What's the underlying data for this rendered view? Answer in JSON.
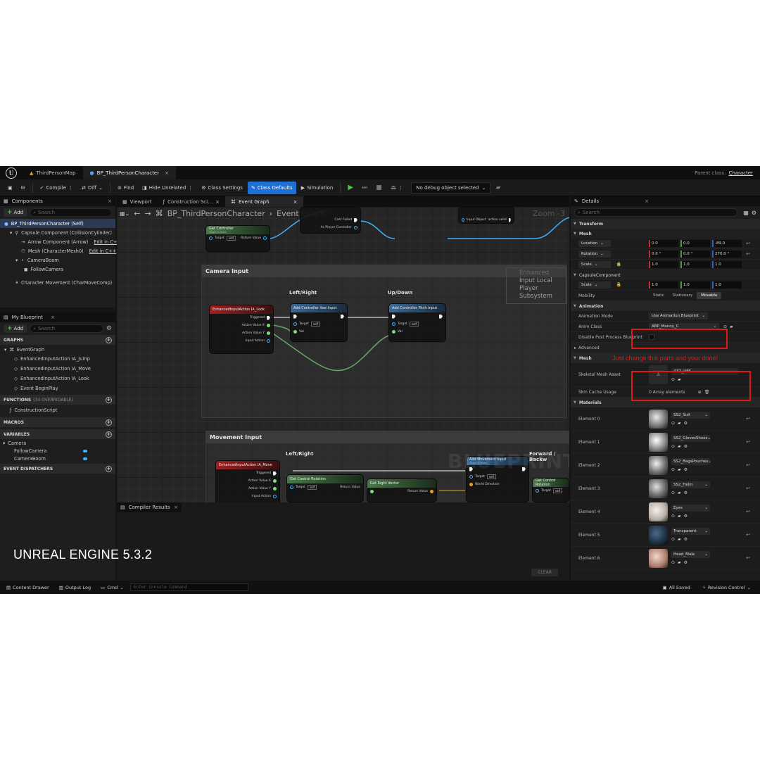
{
  "titlebar": {
    "tabs": [
      {
        "label": "ThirdPersonMap"
      },
      {
        "label": "BP_ThirdPersonCharacter"
      }
    ],
    "parent_class_label": "Parent class:",
    "parent_class_value": "Character"
  },
  "toolbar": {
    "compile": "Compile",
    "diff": "Diff",
    "find": "Find",
    "hide_unrelated": "Hide Unrelated",
    "class_settings": "Class Settings",
    "class_defaults": "Class Defaults",
    "simulation": "Simulation",
    "debug_object": "No debug object selected"
  },
  "components": {
    "title": "Components",
    "add": "Add",
    "search_placeholder": "Search",
    "items": [
      {
        "label": "BP_ThirdPersonCharacter (Self)"
      },
      {
        "label": "Capsule Component (CollisionCylinder)"
      },
      {
        "label": "Arrow Component (Arrow)",
        "link": "Edit in C++"
      },
      {
        "label": "Mesh (CharacterMesh0)",
        "link": "Edit in C++"
      },
      {
        "label": "CameraBoom"
      },
      {
        "label": "FollowCamera"
      },
      {
        "label": "Character Movement (CharMoveComp)"
      }
    ]
  },
  "my_blueprint": {
    "title": "My Blueprint",
    "add": "Add",
    "search_placeholder": "Search",
    "graphs_label": "GRAPHS",
    "event_graph": "EventGraph",
    "events": [
      "EnhancedInputAction IA_Jump",
      "EnhancedInputAction IA_Move",
      "EnhancedInputAction IA_Look",
      "Event BeginPlay"
    ],
    "functions_label": "FUNCTIONS",
    "functions_sub": "(34 OVERRIDABLE)",
    "functions": [
      "ConstructionScript"
    ],
    "macros_label": "MACROS",
    "variables_label": "VARIABLES",
    "var_category": "Camera",
    "variables": [
      "FollowCamera",
      "CameraBoom"
    ],
    "dispatchers_label": "EVENT DISPATCHERS"
  },
  "graph_tabs": [
    "Viewport",
    "Construction Scr...",
    "Event Graph"
  ],
  "graph": {
    "crumb_root": "BP_ThirdPersonCharacter",
    "crumb_leaf": "Event Graph",
    "zoom": "Zoom -3",
    "get_controller": "Get Controller",
    "target_is_pawn": "Target is Pawn",
    "target": "Target",
    "self": "self",
    "return_value": "Return Value",
    "cast_failed": "Cast Failed",
    "as_player_controller": "As Player Controller",
    "input_object": "Input Object",
    "action_valid": "action valid",
    "eil": "Enhanced Input Local Player Subsystem",
    "camera_input": "Camera Input",
    "left_right": "Left/Right",
    "up_down": "Up/Down",
    "look_node": "EnhancedInputAction IA_Look",
    "triggered": "Triggered",
    "action_value_x": "Action Value X",
    "action_value_y": "Action Value Y",
    "input_action": "Input Action",
    "yaw_node": "Add Controller Yaw Input",
    "pitch_node": "Add Controller Pitch Input",
    "val": "Val",
    "movement_input": "Movement Input",
    "forward_back": "Forward / Backw",
    "move_node": "EnhancedInputAction IA_Move",
    "get_control_rotation": "Get Control Rotation",
    "get_right_vector": "Get Right Vector",
    "add_movement_input": "Add Movement Input",
    "world_direction": "World Direction",
    "watermark": "BLUEPRINT"
  },
  "compiler": {
    "title": "Compiler Results",
    "clear": "CLEAR"
  },
  "overlay_caption": "UNREAL ENGINE 5.3.2",
  "details": {
    "title": "Details",
    "search_placeholder": "Search",
    "transform": "Transform",
    "mesh_sec": "Mesh",
    "location": "Location",
    "rotation": "Rotation",
    "scale": "Scale",
    "loc": [
      "0.0",
      "0.0",
      "-89.0"
    ],
    "rot": [
      "0.0 °",
      "0.0 °",
      "270.0 °"
    ],
    "scl": [
      "1.0",
      "1.0",
      "1.0"
    ],
    "capsule_sec": "CapsuleComponent",
    "cap_scl": [
      "1.0",
      "1.0",
      "1.0"
    ],
    "mobility": "Mobility",
    "mob_opts": [
      "Static",
      "Stationary",
      "Movable"
    ],
    "animation": "Animation",
    "anim_mode": "Animation Mode",
    "anim_mode_val": "Use Animation Blueprint",
    "anim_class": "Anim Class",
    "anim_class_val": "ABP_Manny_C",
    "disable_pp": "Disable Post Process Blueprint",
    "advanced": "Advanced",
    "mesh_sec2": "Mesh",
    "skeletal_mesh": "Skeletal Mesh Asset",
    "skeletal_val": "SS2_UE5",
    "skin_cache": "Skin Cache Usage",
    "skin_cache_val": "0 Array elements",
    "materials": "Materials",
    "mats": [
      {
        "label": "Element 0",
        "value": "SS2_Suit"
      },
      {
        "label": "Element 1",
        "value": "SS2_GlovesShoes"
      },
      {
        "label": "Element 2",
        "value": "SS2_BagsPouches"
      },
      {
        "label": "Element 3",
        "value": "SS2_Helm"
      },
      {
        "label": "Element 4",
        "value": "Eyes"
      },
      {
        "label": "Element 5",
        "value": "Transparent"
      },
      {
        "label": "Element 6",
        "value": "Head_Male"
      }
    ]
  },
  "annotation": "Just change this parts and your done!",
  "statusbar": {
    "content_drawer": "Content Drawer",
    "output_log": "Output Log",
    "cmd": "Cmd",
    "console_placeholder": "Enter Console Command",
    "all_saved": "All Saved",
    "revision": "Revision Control"
  },
  "colors": {
    "accent": "#1e6fd6",
    "annotation": "#e01818",
    "exec_wire": "#ffffff",
    "float_wire": "#7be07b",
    "object_wire": "#3db0ff"
  }
}
